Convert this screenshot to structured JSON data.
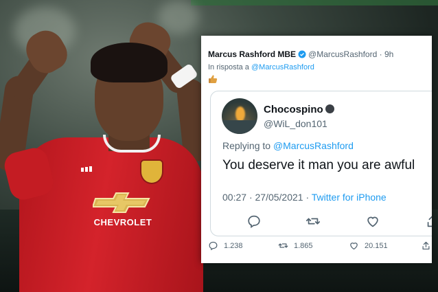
{
  "colors": {
    "link": "#1d9bf0",
    "verified": "#1d9bf0",
    "muted": "#536471",
    "text": "#0f1419",
    "border": "#cfd9de",
    "kit_red": "#d4232b"
  },
  "photo": {
    "sponsor": "CHEVROLET"
  },
  "tweet": {
    "author_name": "Marcus Rashford MBE",
    "verified_icon": "verified-badge-icon",
    "author_handle": "@MarcusRashford",
    "separator": "·",
    "time_ago": "9h",
    "reply_prefix": "In risposta a",
    "reply_to": "@MarcusRashford",
    "body_icon": "thumbs-up-emoji",
    "stats": {
      "replies": "1.238",
      "retweets": "1.865",
      "likes": "20.151"
    }
  },
  "quoted": {
    "name": "Chocospino",
    "name_icon": "dark-circle-emoji",
    "handle": "@WiL_don101",
    "replying_prefix": "Replying to",
    "replying_to": "@MarcusRashford",
    "text": "You deserve it man you are awful",
    "time": "00:27",
    "date": "27/05/2021",
    "separator": "·",
    "source": "Twitter for iPhone"
  }
}
